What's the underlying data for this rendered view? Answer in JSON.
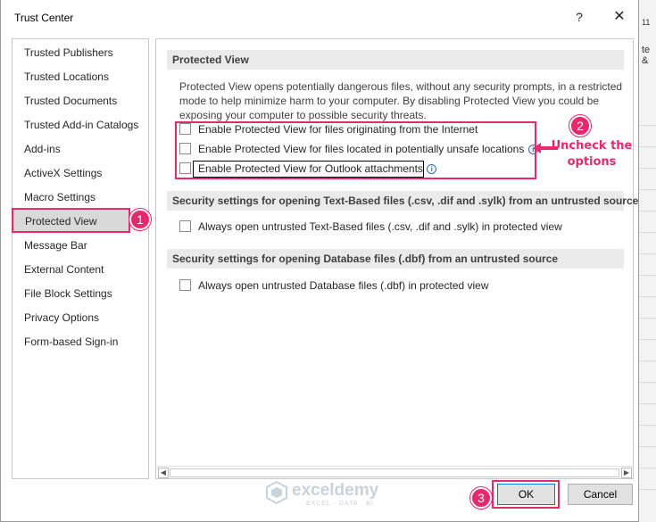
{
  "window": {
    "title": "Trust Center",
    "help_label": "?",
    "close_label": "✕"
  },
  "background": {
    "fragment_top": "te &"
  },
  "sidebar": {
    "items": [
      {
        "label": "Trusted Publishers"
      },
      {
        "label": "Trusted Locations"
      },
      {
        "label": "Trusted Documents"
      },
      {
        "label": "Trusted Add-in Catalogs"
      },
      {
        "label": "Add-ins"
      },
      {
        "label": "ActiveX Settings"
      },
      {
        "label": "Macro Settings"
      },
      {
        "label": "Protected View",
        "selected": true
      },
      {
        "label": "Message Bar"
      },
      {
        "label": "External Content"
      },
      {
        "label": "File Block Settings"
      },
      {
        "label": "Privacy Options"
      },
      {
        "label": "Form-based Sign-in"
      }
    ]
  },
  "panel": {
    "protected_view": {
      "header": "Protected View",
      "description": "Protected View opens potentially dangerous files, without any security prompts, in a restricted mode to help minimize harm to your computer. By disabling Protected View you could be exposing your computer to possible security threats.",
      "options": [
        {
          "label": "Enable Protected View for files originating from the Internet",
          "checked": false
        },
        {
          "label": "Enable Protected View for files located in potentially unsafe locations",
          "checked": false,
          "info": "i"
        },
        {
          "label": "Enable Protected View for Outlook attachments",
          "checked": false,
          "info": "i"
        }
      ]
    },
    "text_based": {
      "header": "Security settings for opening Text-Based files (.csv, .dif and .sylk) from an untrusted source",
      "option": "Always open untrusted Text-Based files (.csv, .dif and .sylk) in protected view",
      "checked": false
    },
    "database": {
      "header": "Security settings for opening Database files (.dbf) from an untrusted source",
      "option": "Always open untrusted Database files (.dbf) in protected view",
      "checked": false
    }
  },
  "annotations": {
    "badge1": "1",
    "badge2": "2",
    "badge3": "3",
    "note": "Uncheck the options"
  },
  "footer": {
    "ok_label": "OK",
    "cancel_label": "Cancel"
  },
  "watermark": {
    "name": "exceldemy",
    "tagline": "EXCEL · DATA · BI"
  },
  "colors": {
    "annotation": "#e6286e",
    "selected_bg": "#d9d9d9",
    "section_header_bg": "#eaeaea"
  }
}
